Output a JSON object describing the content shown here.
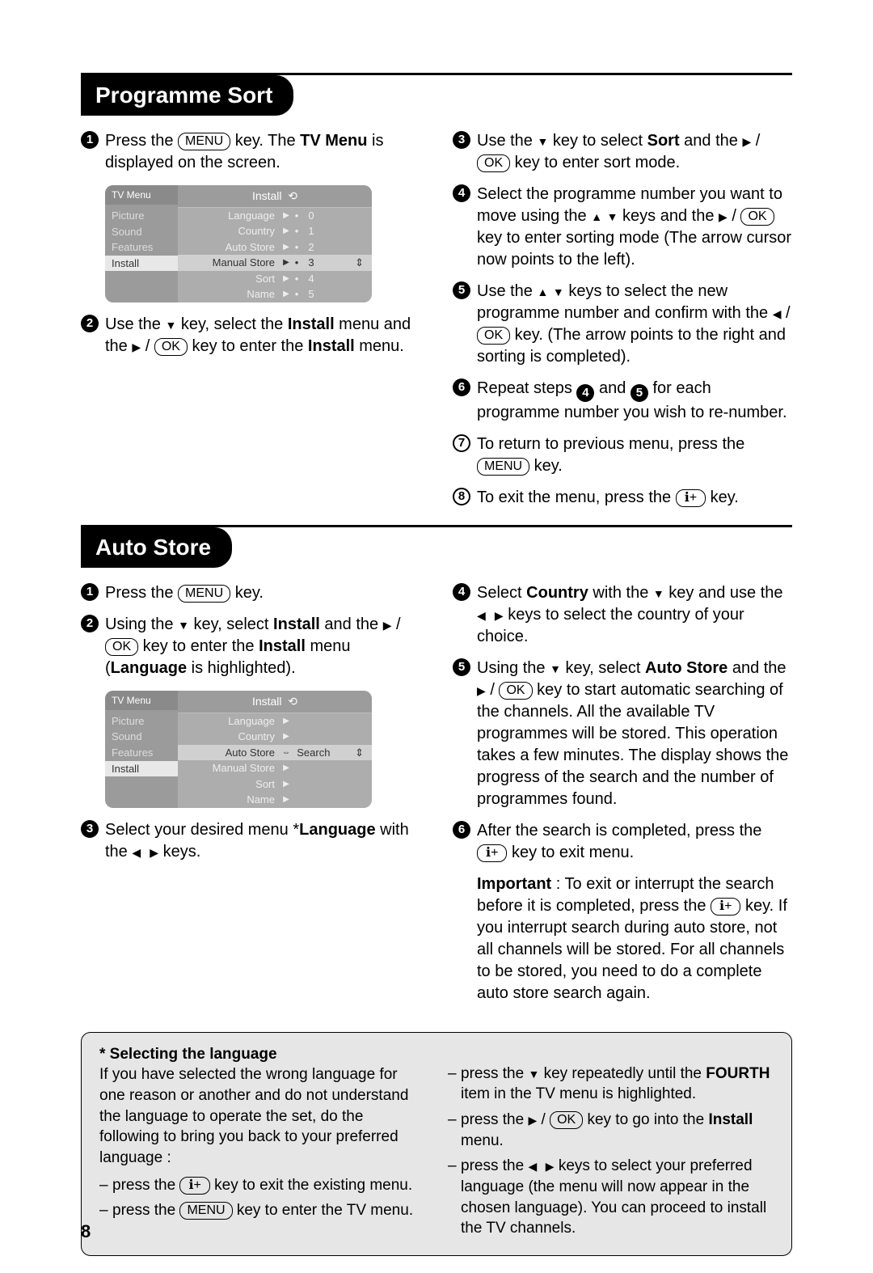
{
  "page_number": "8",
  "sections": {
    "sort": {
      "title": "Programme Sort"
    },
    "auto": {
      "title": "Auto Store"
    }
  },
  "keys": {
    "menu": "MENU",
    "ok": "OK"
  },
  "arrows": {
    "up": "▲",
    "down": "▼",
    "left": "◀",
    "right": "▶"
  },
  "sort_steps": {
    "s1a": "Press the ",
    "s1b": " key. The ",
    "s1c": "TV Menu",
    "s1d": " is displayed on the screen.",
    "s2a": "Use the ",
    "s2b": " key, select the ",
    "s2c": "Install",
    "s2d": " menu and the ",
    "s2e": " key to enter the ",
    "s2f": "Install",
    "s2g": " menu.",
    "s3a": "Use the ",
    "s3b": " key to select ",
    "s3c": "Sort",
    "s3d": " and the ",
    "s3e": " key to enter sort mode.",
    "s4a": "Select the programme number you want to move using the ",
    "s4b": " keys and the ",
    "s4c": " key to enter sorting mode (The arrow cursor now points to the left).",
    "s5a": "Use the ",
    "s5b": "  keys to select the new programme number and confirm with the ",
    "s5c": " key. (The arrow points to the right and  sorting is completed).",
    "s6a": "Repeat steps ",
    "s6b": " and ",
    "s6c": "  for each programme number you wish to re-number.",
    "s7a": "To return to previous menu, press the ",
    "s7b": " key.",
    "s8a": "To exit the menu, press the ",
    "s8b": "  key."
  },
  "auto_steps": {
    "a1a": "Press the ",
    "a1b": "  key.",
    "a2a": "Using the ",
    "a2b": " key, select ",
    "a2c": "Install",
    "a2d": " and the ",
    "a2e": " key to enter the ",
    "a2f": "Install",
    "a2g": " menu (",
    "a2h": "Language",
    "a2i": " is highlighted).",
    "a3a": "Select your desired menu *",
    "a3b": "Language",
    "a3c": " with the ",
    "a3d": " keys.",
    "a4a": "Select ",
    "a4b": "Country",
    "a4c": " with the ",
    "a4d": " key and use the ",
    "a4e": " keys to select the country of your choice.",
    "a5a": "Using the ",
    "a5b": " key, select ",
    "a5c": "Auto Store",
    "a5d": " and the ",
    "a5e": " key to start automatic searching of the channels. All the available TV programmes will be stored. This operation takes a few minutes. The display shows the progress of the search and the number of programmes found.",
    "a6a": "After the search is completed, press the ",
    "a6b": "  key to exit menu.",
    "impa": "Important",
    "impb": " : To exit or interrupt the search before it is completed, press the ",
    "impc": "  key. If you interrupt search during auto store, not all channels will be stored. For all channels to be stored, you need to do a complete auto store search again."
  },
  "tv1": {
    "head_left": "TV Menu",
    "head_main": "Install",
    "side": [
      "Picture",
      "Sound",
      "Features",
      "Install"
    ],
    "rows": [
      {
        "label": "Language",
        "val": "0",
        "sel": false
      },
      {
        "label": "Country",
        "val": "1",
        "sel": false
      },
      {
        "label": "Auto Store",
        "val": "2",
        "sel": false
      },
      {
        "label": "Manual Store",
        "val": "3",
        "sel": true
      },
      {
        "label": "Sort",
        "val": "4",
        "sel": false
      },
      {
        "label": "Name",
        "val": "5",
        "sel": false
      }
    ]
  },
  "tv2": {
    "head_left": "TV Menu",
    "head_main": "Install",
    "side": [
      "Picture",
      "Sound",
      "Features",
      "Install"
    ],
    "rows": [
      {
        "label": "Language",
        "extra": "",
        "sel": false
      },
      {
        "label": "Country",
        "extra": "",
        "sel": false
      },
      {
        "label": "Auto Store",
        "extra": "Search",
        "sel": true
      },
      {
        "label": "Manual Store",
        "extra": "",
        "sel": false
      },
      {
        "label": "Sort",
        "extra": "",
        "sel": false
      },
      {
        "label": "Name",
        "extra": "",
        "sel": false
      }
    ]
  },
  "info": {
    "title": "* Selecting the language",
    "intro": "If you have selected the wrong language for one reason or another and do not understand the language to operate the set, do the following to bring you back to your preferred language :",
    "l1a": "press the ",
    "l1b": " key to exit the existing menu.",
    "l2a": "press the ",
    "l2b": " key to enter the TV menu.",
    "r1a": "press the ",
    "r1b": " key repeatedly until the ",
    "r1c": "FOURTH",
    "r1d": " item in the TV menu is highlighted.",
    "r2a": "press the ",
    "r2b": " key to go into the ",
    "r2c": "Install",
    "r2d": " menu.",
    "r3a": "press the ",
    "r3b": " keys to select your preferred language (the menu will now appear in the chosen language). You can proceed to install the  TV channels."
  }
}
